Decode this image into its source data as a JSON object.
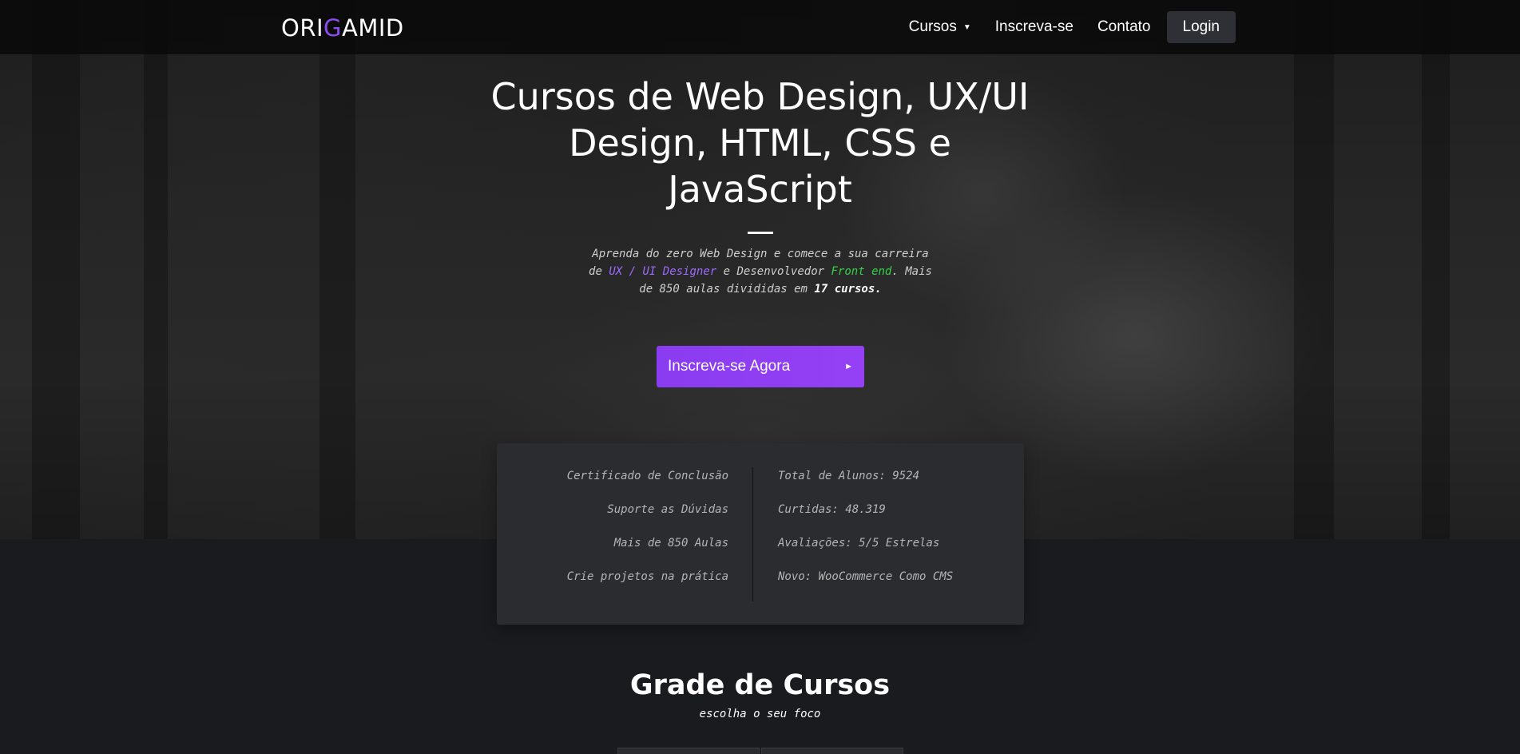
{
  "brand": {
    "logo_text_a": "ORI",
    "logo_text_g": "G",
    "logo_text_b": "AMID"
  },
  "nav": {
    "items": [
      {
        "label": "Cursos",
        "has_dropdown": true
      },
      {
        "label": "Inscreva-se"
      },
      {
        "label": "Contato"
      }
    ],
    "login_label": "Login"
  },
  "hero": {
    "headline": "Cursos de Web Design, UX/UI Design, HTML, CSS e JavaScript",
    "lead_part1": "Aprenda do zero Web Design e comece a sua carreira de ",
    "lead_highlight1": "UX / UI Designer",
    "lead_part2": " e Desenvolvedor ",
    "lead_highlight2": "Front end",
    "lead_part3": ". Mais de 850 aulas divididas em ",
    "lead_bold": "17 cursos.",
    "cta_label": "Inscreva-se Agora"
  },
  "features": {
    "left": [
      "Certificado de Conclusão",
      "Suporte as Dúvidas",
      "Mais de 850 Aulas",
      "Crie projetos na prática"
    ],
    "right": [
      "Total de Alunos: 9524",
      "Curtidas: 48.319",
      "Avaliações: 5/5 Estrelas",
      "Novo: WooCommerce Como CMS"
    ]
  },
  "courses": {
    "title": "Grade de Cursos",
    "subtitle": "escolha o seu foco"
  },
  "colors": {
    "accent": "#8d4cf2",
    "green": "#34d24a",
    "panel": "#2b2c30",
    "background": "#1a1b1f"
  }
}
